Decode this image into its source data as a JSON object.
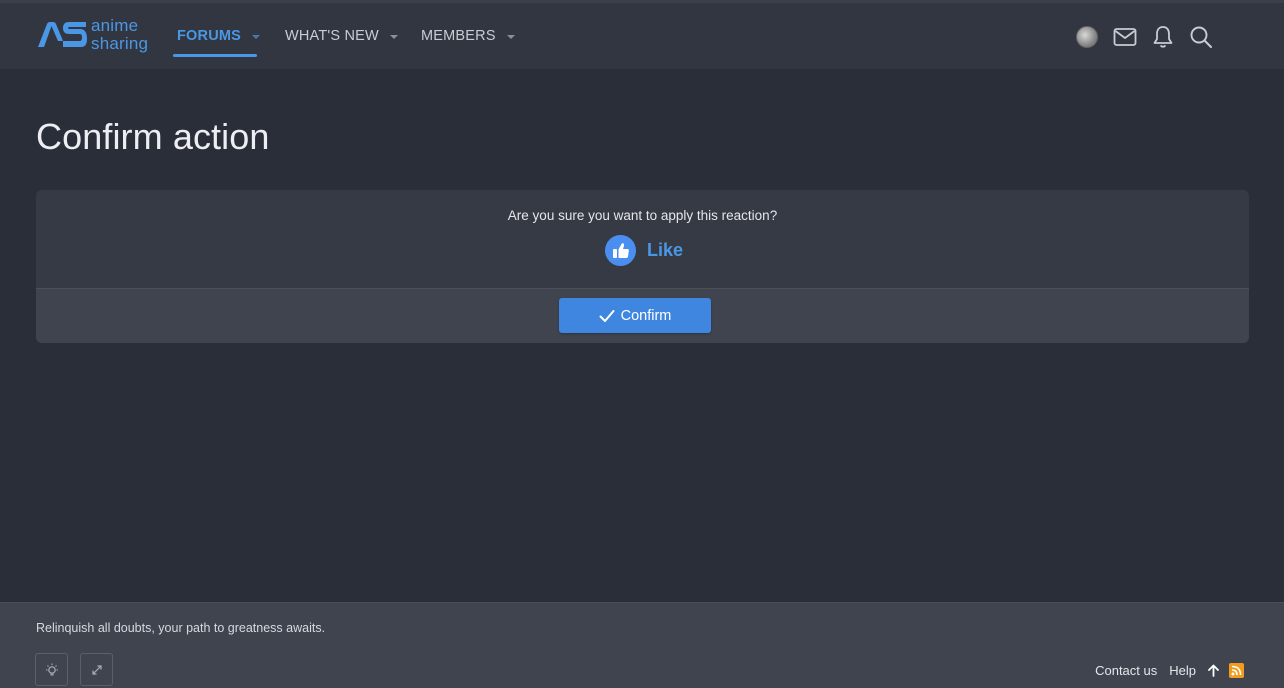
{
  "brand": {
    "logo_mark": "AS",
    "word_line1": "anime",
    "word_line2": "sharing",
    "accent": "#4a97e6"
  },
  "nav": {
    "items": [
      {
        "label": "FORUMS",
        "active": true
      },
      {
        "label": "WHAT'S NEW",
        "active": false
      },
      {
        "label": "MEMBERS",
        "active": false
      }
    ]
  },
  "header_icons": [
    "avatar",
    "envelope-icon",
    "bell-icon",
    "search-icon"
  ],
  "page": {
    "title": "Confirm action"
  },
  "dialog": {
    "question": "Are you sure you want to apply this reaction?",
    "reaction_label": "Like",
    "reaction_icon": "thumbs-up-icon",
    "confirm_label": "Confirm"
  },
  "footer": {
    "tagline": "Relinquish all doubts, your path to greatness awaits.",
    "tools": [
      "lightbulb-icon",
      "expand-icon"
    ],
    "links": {
      "contact": "Contact us",
      "help": "Help"
    },
    "rss_color": "#f29c1f"
  }
}
